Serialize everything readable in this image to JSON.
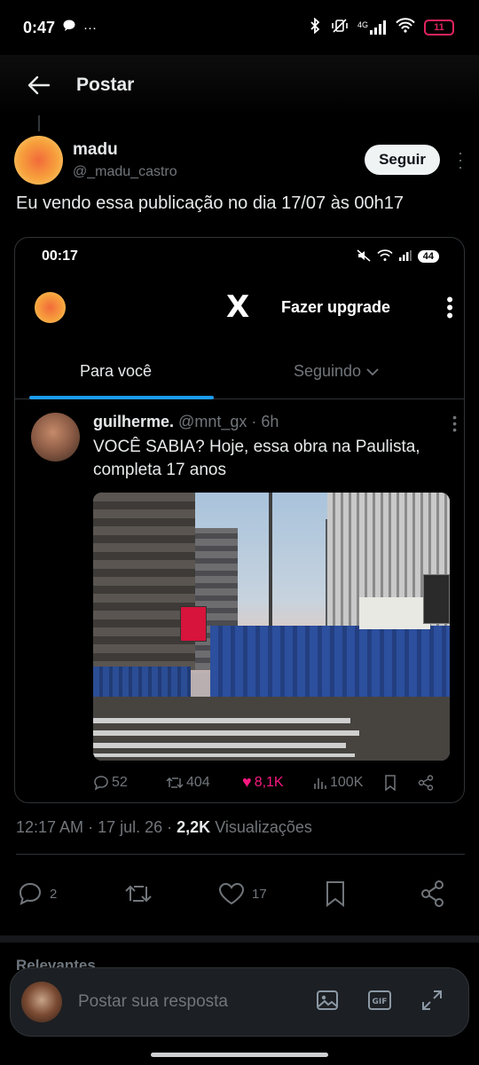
{
  "status_bar": {
    "time": "0:47",
    "left_extra": "···",
    "network": "4G",
    "battery": "11"
  },
  "nav": {
    "title": "Postar"
  },
  "post": {
    "author_name": "madu",
    "author_handle": "@_madu_castro",
    "follow_label": "Seguir",
    "text": "Eu vendo essa publicação no dia 17/07 às 00h17",
    "timestamp": "12:17 AM",
    "date": "17 jul. 26",
    "views_count": "2,2K",
    "views_label": "Visualizações",
    "reply_count": "2",
    "like_count": "17"
  },
  "embedded_screenshot": {
    "time": "00:17",
    "battery": "44",
    "upgrade_label": "Fazer upgrade",
    "x_logo": "X",
    "tabs": [
      {
        "label": "Para você",
        "active": true
      },
      {
        "label": "Seguindo",
        "active": false
      }
    ],
    "tweet": {
      "name": "guilherme.",
      "handle": "@mnt_gx",
      "time": "6h",
      "text": "VOCÊ SABIA? Hoje, essa obra na Paulista, completa 17 anos",
      "replies": "52",
      "retweets": "404",
      "likes": "8,1K",
      "views": "100K"
    }
  },
  "relevant_label": "Relevantes",
  "reply_box": {
    "placeholder": "Postar sua resposta"
  },
  "colors": {
    "background": "#000000",
    "text_primary": "#e7e9ea",
    "text_secondary": "#71767b",
    "accent_blue": "#1d9bf0",
    "like_pink": "#f91880",
    "battery_red": "#e0245e"
  }
}
